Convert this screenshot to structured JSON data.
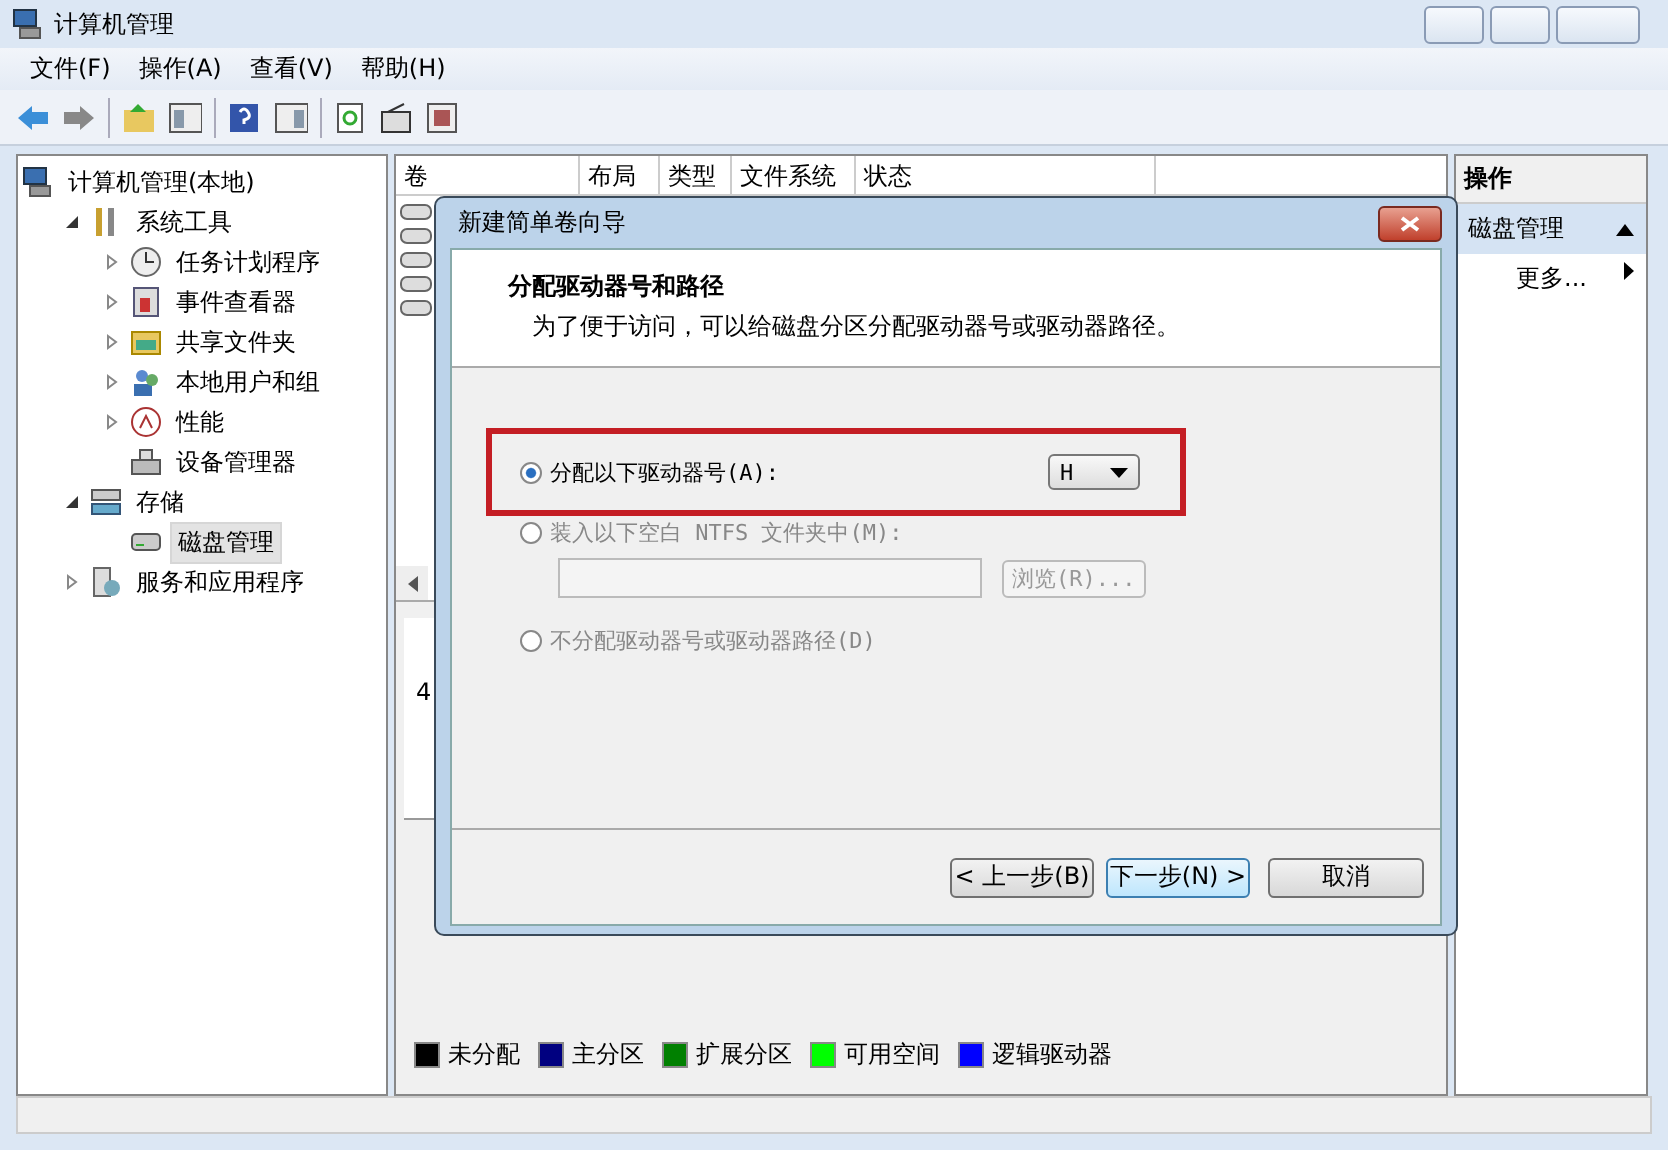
{
  "window": {
    "title": "计算机管理"
  },
  "menu": [
    "文件(F)",
    "操作(A)",
    "查看(V)",
    "帮助(H)"
  ],
  "tree": [
    {
      "label": "计算机管理(本地)",
      "selected": false,
      "children": [
        {
          "label": "系统工具",
          "selected": false,
          "expanded": true,
          "children": [
            {
              "label": "任务计划程序",
              "selected": false,
              "expanded": false
            },
            {
              "label": "事件查看器",
              "selected": false,
              "expanded": false
            },
            {
              "label": "共享文件夹",
              "selected": false,
              "expanded": false
            },
            {
              "label": "本地用户和组",
              "selected": false,
              "expanded": false
            },
            {
              "label": "性能",
              "selected": false,
              "expanded": false
            },
            {
              "label": "设备管理器",
              "selected": false
            }
          ]
        },
        {
          "label": "存储",
          "selected": false,
          "expanded": true,
          "children": [
            {
              "label": "磁盘管理",
              "selected": true
            }
          ]
        },
        {
          "label": "服务和应用程序",
          "selected": false,
          "expanded": false
        }
      ]
    }
  ],
  "columns": [
    "卷",
    "布局",
    "类型",
    "文件系统",
    "状态"
  ],
  "lower_pane_fragments": [
    "4"
  ],
  "legend": [
    {
      "label": "未分配",
      "color": "#000000"
    },
    {
      "label": "主分区",
      "color": "#000080"
    },
    {
      "label": "扩展分区",
      "color": "#008000"
    },
    {
      "label": "可用空间",
      "color": "#00ff00"
    },
    {
      "label": "逻辑驱动器",
      "color": "#0000ff"
    }
  ],
  "actions": {
    "title": "操作",
    "section": "磁盘管理",
    "items": [
      "更多..."
    ]
  },
  "dialog": {
    "title": "新建简单卷向导",
    "heading": "分配驱动器号和路径",
    "description": "为了便于访问，可以给磁盘分区分配驱动器号或驱动器路径。",
    "options": [
      {
        "kind": "letter",
        "label": "分配以下驱动器号(A):",
        "selected": true,
        "highlighted": true,
        "value": "H"
      },
      {
        "kind": "folder",
        "label": "装入以下空白 NTFS 文件夹中(M):",
        "selected": false,
        "highlighted": false,
        "browse": "浏览(R)..."
      },
      {
        "kind": "none",
        "label": "不分配驱动器号或驱动器路径(D)",
        "selected": false,
        "highlighted": false
      }
    ],
    "buttons": [
      {
        "label": "< 上一步(B)",
        "default": false
      },
      {
        "label": "下一步(N) >",
        "default": true
      },
      {
        "label": "取消",
        "default": false
      }
    ]
  }
}
